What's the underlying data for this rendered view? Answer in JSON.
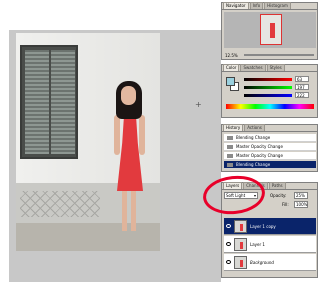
{
  "navigator": {
    "tabs": [
      "Navigator",
      "Info",
      "Histogram"
    ],
    "zoom": "12.5%"
  },
  "color": {
    "tabs": [
      "Color",
      "Swatches",
      "Styles"
    ],
    "values": [
      "63",
      "197",
      "222"
    ],
    "foreground_hex": "#9ad0de"
  },
  "history": {
    "tabs": [
      "History",
      "Actions"
    ],
    "items": [
      "Blending Change",
      "Master Opacity Change",
      "Master Opacity Change",
      "Blending Change"
    ],
    "selected_index": 3
  },
  "layers": {
    "tabs": [
      "Layers",
      "Channels",
      "Paths"
    ],
    "blend_mode": "Soft Light",
    "opacity_label": "Opacity:",
    "opacity": "25%",
    "fill_label": "Fill:",
    "fill": "100%",
    "items": [
      "Layer 1 copy",
      "Layer 1",
      "Background"
    ],
    "selected_index": 0
  },
  "annotation_color": "#e8002a",
  "accent_color": "#0a246a"
}
